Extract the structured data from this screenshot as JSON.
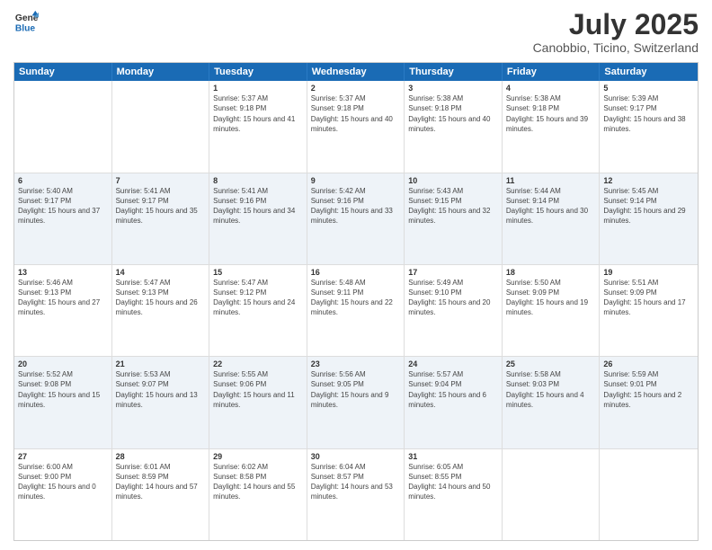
{
  "header": {
    "logo_line1": "General",
    "logo_line2": "Blue",
    "month": "July 2025",
    "location": "Canobbio, Ticino, Switzerland"
  },
  "days_of_week": [
    "Sunday",
    "Monday",
    "Tuesday",
    "Wednesday",
    "Thursday",
    "Friday",
    "Saturday"
  ],
  "rows": [
    [
      {
        "day": "",
        "sunrise": "",
        "sunset": "",
        "daylight": ""
      },
      {
        "day": "",
        "sunrise": "",
        "sunset": "",
        "daylight": ""
      },
      {
        "day": "1",
        "sunrise": "Sunrise: 5:37 AM",
        "sunset": "Sunset: 9:18 PM",
        "daylight": "Daylight: 15 hours and 41 minutes."
      },
      {
        "day": "2",
        "sunrise": "Sunrise: 5:37 AM",
        "sunset": "Sunset: 9:18 PM",
        "daylight": "Daylight: 15 hours and 40 minutes."
      },
      {
        "day": "3",
        "sunrise": "Sunrise: 5:38 AM",
        "sunset": "Sunset: 9:18 PM",
        "daylight": "Daylight: 15 hours and 40 minutes."
      },
      {
        "day": "4",
        "sunrise": "Sunrise: 5:38 AM",
        "sunset": "Sunset: 9:18 PM",
        "daylight": "Daylight: 15 hours and 39 minutes."
      },
      {
        "day": "5",
        "sunrise": "Sunrise: 5:39 AM",
        "sunset": "Sunset: 9:17 PM",
        "daylight": "Daylight: 15 hours and 38 minutes."
      }
    ],
    [
      {
        "day": "6",
        "sunrise": "Sunrise: 5:40 AM",
        "sunset": "Sunset: 9:17 PM",
        "daylight": "Daylight: 15 hours and 37 minutes."
      },
      {
        "day": "7",
        "sunrise": "Sunrise: 5:41 AM",
        "sunset": "Sunset: 9:17 PM",
        "daylight": "Daylight: 15 hours and 35 minutes."
      },
      {
        "day": "8",
        "sunrise": "Sunrise: 5:41 AM",
        "sunset": "Sunset: 9:16 PM",
        "daylight": "Daylight: 15 hours and 34 minutes."
      },
      {
        "day": "9",
        "sunrise": "Sunrise: 5:42 AM",
        "sunset": "Sunset: 9:16 PM",
        "daylight": "Daylight: 15 hours and 33 minutes."
      },
      {
        "day": "10",
        "sunrise": "Sunrise: 5:43 AM",
        "sunset": "Sunset: 9:15 PM",
        "daylight": "Daylight: 15 hours and 32 minutes."
      },
      {
        "day": "11",
        "sunrise": "Sunrise: 5:44 AM",
        "sunset": "Sunset: 9:14 PM",
        "daylight": "Daylight: 15 hours and 30 minutes."
      },
      {
        "day": "12",
        "sunrise": "Sunrise: 5:45 AM",
        "sunset": "Sunset: 9:14 PM",
        "daylight": "Daylight: 15 hours and 29 minutes."
      }
    ],
    [
      {
        "day": "13",
        "sunrise": "Sunrise: 5:46 AM",
        "sunset": "Sunset: 9:13 PM",
        "daylight": "Daylight: 15 hours and 27 minutes."
      },
      {
        "day": "14",
        "sunrise": "Sunrise: 5:47 AM",
        "sunset": "Sunset: 9:13 PM",
        "daylight": "Daylight: 15 hours and 26 minutes."
      },
      {
        "day": "15",
        "sunrise": "Sunrise: 5:47 AM",
        "sunset": "Sunset: 9:12 PM",
        "daylight": "Daylight: 15 hours and 24 minutes."
      },
      {
        "day": "16",
        "sunrise": "Sunrise: 5:48 AM",
        "sunset": "Sunset: 9:11 PM",
        "daylight": "Daylight: 15 hours and 22 minutes."
      },
      {
        "day": "17",
        "sunrise": "Sunrise: 5:49 AM",
        "sunset": "Sunset: 9:10 PM",
        "daylight": "Daylight: 15 hours and 20 minutes."
      },
      {
        "day": "18",
        "sunrise": "Sunrise: 5:50 AM",
        "sunset": "Sunset: 9:09 PM",
        "daylight": "Daylight: 15 hours and 19 minutes."
      },
      {
        "day": "19",
        "sunrise": "Sunrise: 5:51 AM",
        "sunset": "Sunset: 9:09 PM",
        "daylight": "Daylight: 15 hours and 17 minutes."
      }
    ],
    [
      {
        "day": "20",
        "sunrise": "Sunrise: 5:52 AM",
        "sunset": "Sunset: 9:08 PM",
        "daylight": "Daylight: 15 hours and 15 minutes."
      },
      {
        "day": "21",
        "sunrise": "Sunrise: 5:53 AM",
        "sunset": "Sunset: 9:07 PM",
        "daylight": "Daylight: 15 hours and 13 minutes."
      },
      {
        "day": "22",
        "sunrise": "Sunrise: 5:55 AM",
        "sunset": "Sunset: 9:06 PM",
        "daylight": "Daylight: 15 hours and 11 minutes."
      },
      {
        "day": "23",
        "sunrise": "Sunrise: 5:56 AM",
        "sunset": "Sunset: 9:05 PM",
        "daylight": "Daylight: 15 hours and 9 minutes."
      },
      {
        "day": "24",
        "sunrise": "Sunrise: 5:57 AM",
        "sunset": "Sunset: 9:04 PM",
        "daylight": "Daylight: 15 hours and 6 minutes."
      },
      {
        "day": "25",
        "sunrise": "Sunrise: 5:58 AM",
        "sunset": "Sunset: 9:03 PM",
        "daylight": "Daylight: 15 hours and 4 minutes."
      },
      {
        "day": "26",
        "sunrise": "Sunrise: 5:59 AM",
        "sunset": "Sunset: 9:01 PM",
        "daylight": "Daylight: 15 hours and 2 minutes."
      }
    ],
    [
      {
        "day": "27",
        "sunrise": "Sunrise: 6:00 AM",
        "sunset": "Sunset: 9:00 PM",
        "daylight": "Daylight: 15 hours and 0 minutes."
      },
      {
        "day": "28",
        "sunrise": "Sunrise: 6:01 AM",
        "sunset": "Sunset: 8:59 PM",
        "daylight": "Daylight: 14 hours and 57 minutes."
      },
      {
        "day": "29",
        "sunrise": "Sunrise: 6:02 AM",
        "sunset": "Sunset: 8:58 PM",
        "daylight": "Daylight: 14 hours and 55 minutes."
      },
      {
        "day": "30",
        "sunrise": "Sunrise: 6:04 AM",
        "sunset": "Sunset: 8:57 PM",
        "daylight": "Daylight: 14 hours and 53 minutes."
      },
      {
        "day": "31",
        "sunrise": "Sunrise: 6:05 AM",
        "sunset": "Sunset: 8:55 PM",
        "daylight": "Daylight: 14 hours and 50 minutes."
      },
      {
        "day": "",
        "sunrise": "",
        "sunset": "",
        "daylight": ""
      },
      {
        "day": "",
        "sunrise": "",
        "sunset": "",
        "daylight": ""
      }
    ]
  ]
}
